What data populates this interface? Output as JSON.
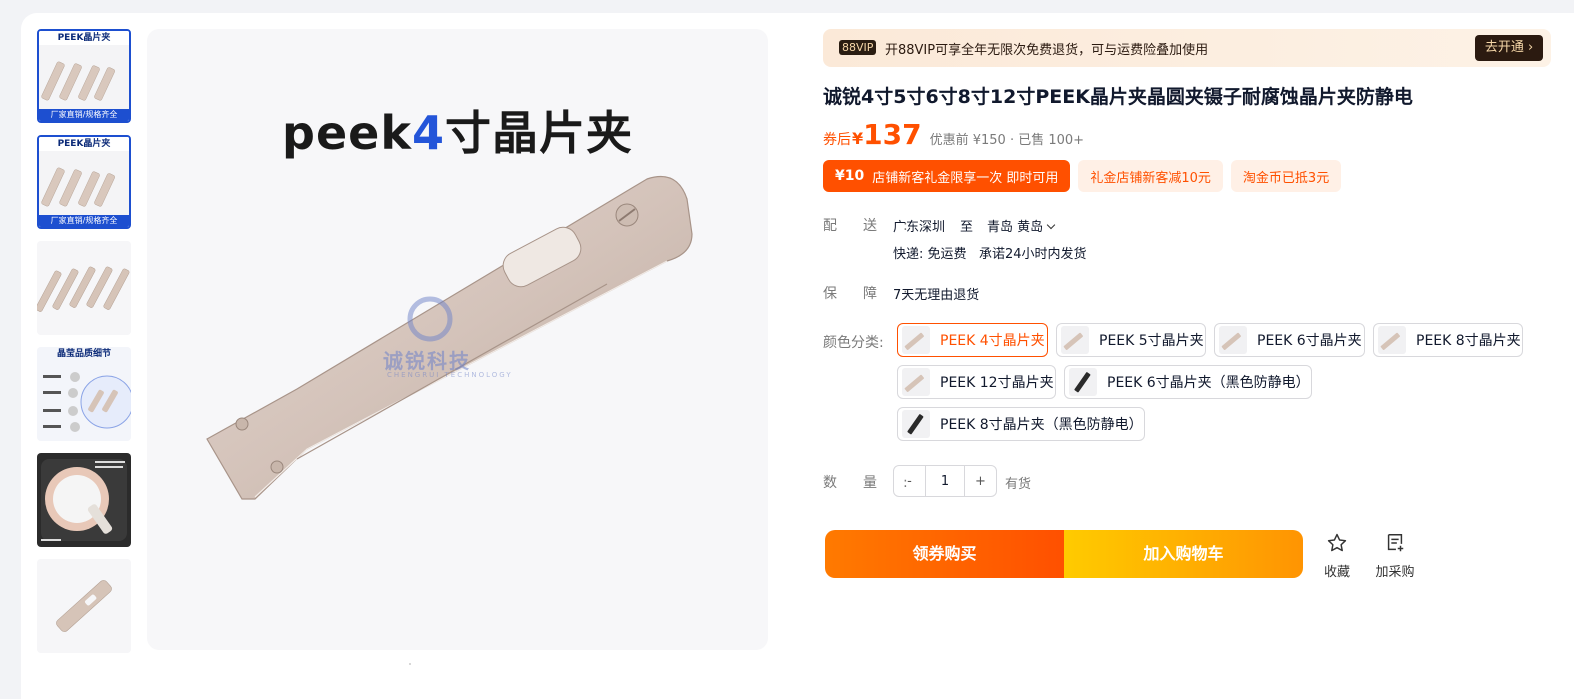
{
  "gallery": {
    "thumbnails": [
      {
        "icon": "product-collage-thumbnail",
        "top_text": "PEEK晶片夹",
        "bottom_text": "厂家直销/规格齐全"
      },
      {
        "icon": "product-collage-thumbnail",
        "top_text": "PEEK晶片夹",
        "bottom_text": "厂家直销/规格齐全"
      },
      {
        "icon": "tweezers-set-thumbnail"
      },
      {
        "icon": "detail-closeup-thumbnail",
        "top_text": "晶莹品质细节"
      },
      {
        "icon": "wafer-holder-thumbnail"
      },
      {
        "icon": "single-tweezer-thumbnail"
      }
    ],
    "main_image": {
      "title_prefix": "peek",
      "title_highlight": "4",
      "title_suffix": "寸晶片夹",
      "watermark": "诚锐科技",
      "watermark_sub": "CHENGRUI TECHNOLOGY"
    }
  },
  "vip": {
    "badge": "88VIP",
    "text": "开88VIP可享全年无限次免费退货，可与运费险叠加使用",
    "button": "去开通 ›"
  },
  "product": {
    "title": "诚锐4寸5寸6寸8寸12寸PEEK晶片夹晶圆夹镊子耐腐蚀晶片夹防静电",
    "price_prefix": "券后",
    "price_symbol": "¥",
    "price": "137",
    "price_note": "优惠前 ¥150 · 已售 100+"
  },
  "coupons": {
    "main_amount": "¥10",
    "main_text": "店铺新客礼金限享一次 即时可用",
    "secondary": [
      "礼金店铺新客减10元",
      "淘金币已抵3元"
    ]
  },
  "shipping": {
    "label": "配送:",
    "from": "广东深圳",
    "to_word": "至",
    "to": "青岛 黄岛",
    "method": "快递: 免运费",
    "promise": "承诺24小时内发货"
  },
  "guarantee": {
    "label": "保障:",
    "value": "7天无理由退货"
  },
  "sku": {
    "label": "颜色分类:",
    "options": [
      "PEEK 4寸晶片夹",
      "PEEK 5寸晶片夹",
      "PEEK 6寸晶片夹",
      "PEEK 8寸晶片夹",
      "PEEK 12寸晶片夹",
      "PEEK 6寸晶片夹（黑色防静电）",
      "PEEK 8寸晶片夹（黑色防静电）"
    ],
    "selected_index": 0
  },
  "quantity": {
    "label": "数量:",
    "minus": "-",
    "value": "1",
    "plus": "+",
    "stock": "有货"
  },
  "actions": {
    "buy": "领券购买",
    "cart": "加入购物车",
    "favorite": "收藏",
    "purchase_list": "加采购"
  },
  "colors": {
    "accent": "#ff5000",
    "vip_bg": "#fbe9d8",
    "cart_gradient_start": "#ffcb00"
  }
}
